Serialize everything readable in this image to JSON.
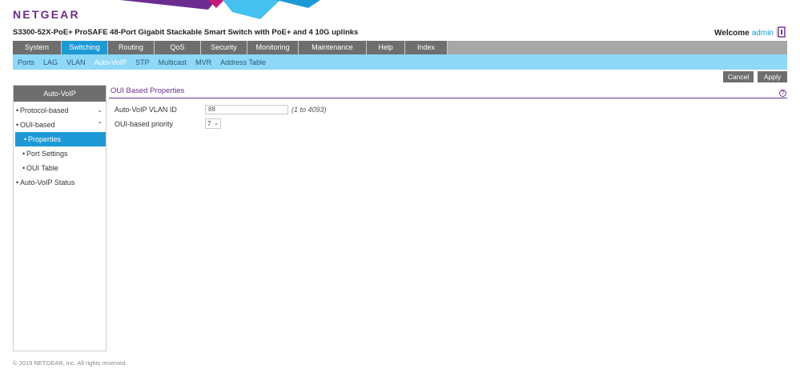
{
  "brand": {
    "logo": "NETGEAR",
    "primary": "#6b2c91",
    "accent": "#1d9ad6"
  },
  "header": {
    "device_title": "S3300-52X-PoE+ ProSAFE 48-Port Gigabit Stackable Smart Switch with PoE+ and 4 10G uplinks",
    "welcome": "Welcome",
    "user": "admin",
    "logout_icon": "logout-icon"
  },
  "topnav": {
    "tabs": [
      {
        "label": "System"
      },
      {
        "label": "Switching"
      },
      {
        "label": "Routing"
      },
      {
        "label": "QoS"
      },
      {
        "label": "Security"
      },
      {
        "label": "Monitoring"
      },
      {
        "label": "Maintenance"
      },
      {
        "label": "Help"
      },
      {
        "label": "Index"
      }
    ],
    "active": "Switching"
  },
  "subnav": {
    "items": [
      "Ports",
      "LAG",
      "VLAN",
      "Auto-VoIP",
      "STP",
      "Multicast",
      "MVR",
      "Address Table"
    ],
    "active": "Auto-VoIP"
  },
  "actions": {
    "cancel": "Cancel",
    "apply": "Apply"
  },
  "sidebar": {
    "title": "Auto-VoIP",
    "items": [
      {
        "label": "Protocol-based",
        "level": 0,
        "chevron": "chevron-down-icon"
      },
      {
        "label": "OUI-based",
        "level": 0,
        "chevron": "chevron-up-icon"
      },
      {
        "label": "Properties",
        "level": 1,
        "active": true
      },
      {
        "label": "Port Settings",
        "level": 1
      },
      {
        "label": "OUI Table",
        "level": 1
      },
      {
        "label": "Auto-VoIP Status",
        "level": 0
      }
    ]
  },
  "main": {
    "section_title": "OUI Based Properties",
    "help_icon": "help-icon",
    "vlan_label": "Auto-VoIP VLAN ID",
    "vlan_value": "88",
    "vlan_range": "(1 to 4093)",
    "priority_label": "OUI-based priority",
    "priority_value": "7"
  },
  "footer": {
    "copyright": "© 2019 NETGEAR, Inc. All rights reserved."
  }
}
